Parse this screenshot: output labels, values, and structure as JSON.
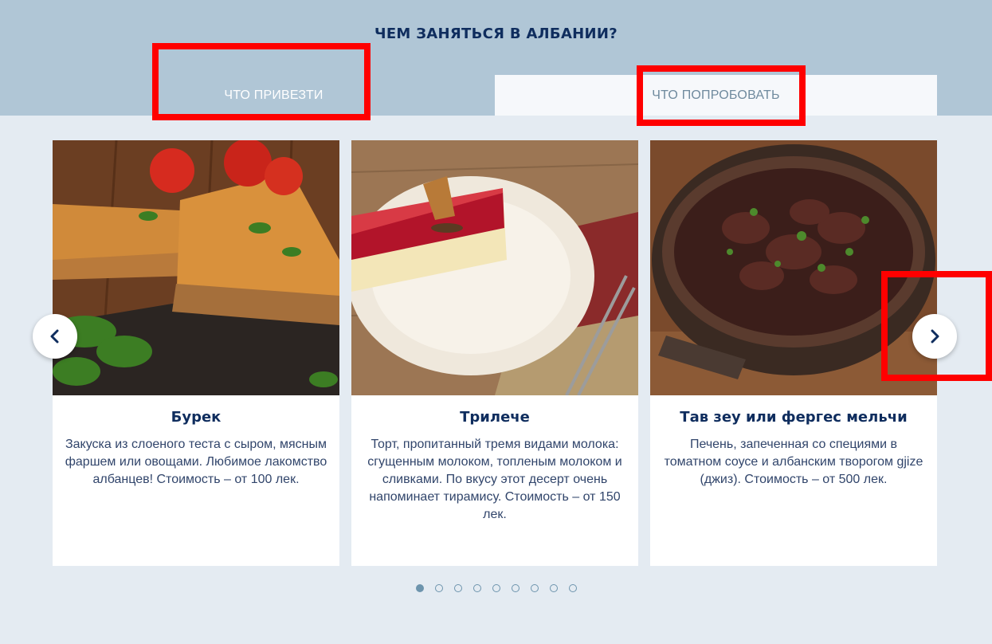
{
  "section": {
    "title": "ЧЕМ ЗАНЯТЬСЯ В АЛБАНИИ?"
  },
  "tabs": [
    {
      "label": "ЧТО ПРИВЕЗТИ",
      "active": false
    },
    {
      "label": "ЧТО ПОПРОБОВАТЬ",
      "active": true
    }
  ],
  "cards": [
    {
      "title": "Бурек",
      "description": "Закуска из слоеного теста с сыром, мясным фаршем или овощами. Любимое лакомство албанцев! Стоимость – от 100 лек.",
      "image": "burek-photo"
    },
    {
      "title": "Трилече",
      "description": "Торт, пропитанный тремя видами молока: сгущенным молоком, топленым молоком и сливками. По вкусу этот десерт очень напоминает тирамису. Стоимость – от 150 лек.",
      "image": "trilece-photo"
    },
    {
      "title": "Тав зеу или фергес мельчи",
      "description": "Печень, запеченная со специями в томатном соусе и албанским творогом gjize (джиз). Стоимость – от 500 лек.",
      "image": "tave-photo"
    }
  ],
  "carousel": {
    "prev_icon": "chevron-left-icon",
    "next_icon": "chevron-right-icon",
    "dots_count": 9,
    "active_dot": 1
  },
  "colors": {
    "header_band": "#b0c6d6",
    "page_bg": "#e4ebf2",
    "title_navy": "#0f2d5e",
    "highlight_red": "#ff0000",
    "dot_blue": "#6d94ad"
  }
}
